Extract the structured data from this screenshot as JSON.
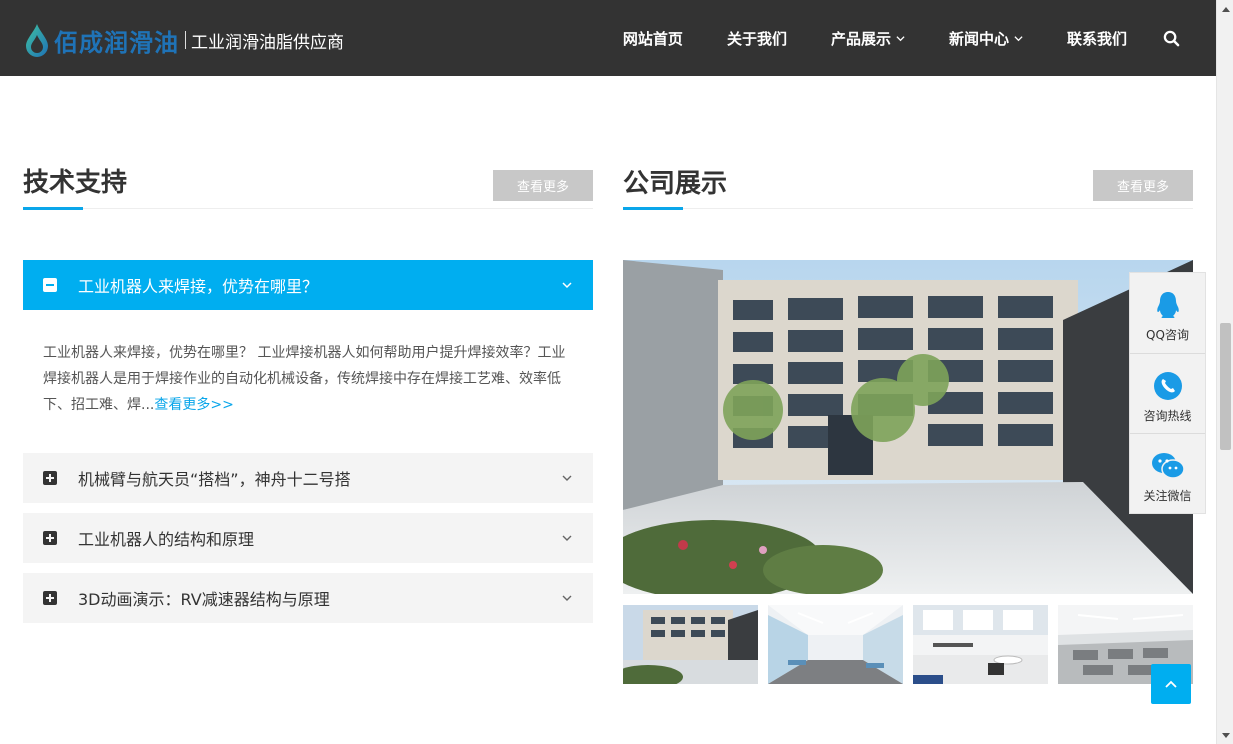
{
  "header": {
    "logo_name": "佰成润滑油",
    "logo_slogan": "工业润滑油脂供应商",
    "nav": [
      {
        "label": "网站首页",
        "has_dropdown": false
      },
      {
        "label": "关于我们",
        "has_dropdown": false
      },
      {
        "label": "产品展示",
        "has_dropdown": true
      },
      {
        "label": "新闻中心",
        "has_dropdown": true
      },
      {
        "label": "联系我们",
        "has_dropdown": false
      }
    ]
  },
  "tech": {
    "title": "技术支持",
    "more_label": "查看更多",
    "active": {
      "title": "工业机器人来焊接，优势在哪里？",
      "body": "工业机器人来焊接，优势在哪里？ 工业焊接机器人如何帮助用户提升焊接效率？工业焊接机器人是用于焊接作业的自动化机械设备，传统焊接中存在焊接工艺难、效率低下、招工难、焊...",
      "read_more": "查看更多>>"
    },
    "items": [
      {
        "title": "机械臂与航天员“搭档”，神舟十二号搭"
      },
      {
        "title": "工业机器人的结构和原理"
      },
      {
        "title": "3D动画演示：RV减速器结构与原理"
      }
    ]
  },
  "company": {
    "title": "公司展示",
    "more_label": "查看更多"
  },
  "float_panel": [
    {
      "label": "QQ咨询",
      "icon": "qq-icon"
    },
    {
      "label": "咨询热线",
      "icon": "phone-icon"
    },
    {
      "label": "关注微信",
      "icon": "wechat-icon"
    }
  ],
  "colors": {
    "header_bg": "#333333",
    "accent": "#00aef0",
    "logo_blue": "#1f73b7",
    "more_btn": "#c8c8c8"
  }
}
